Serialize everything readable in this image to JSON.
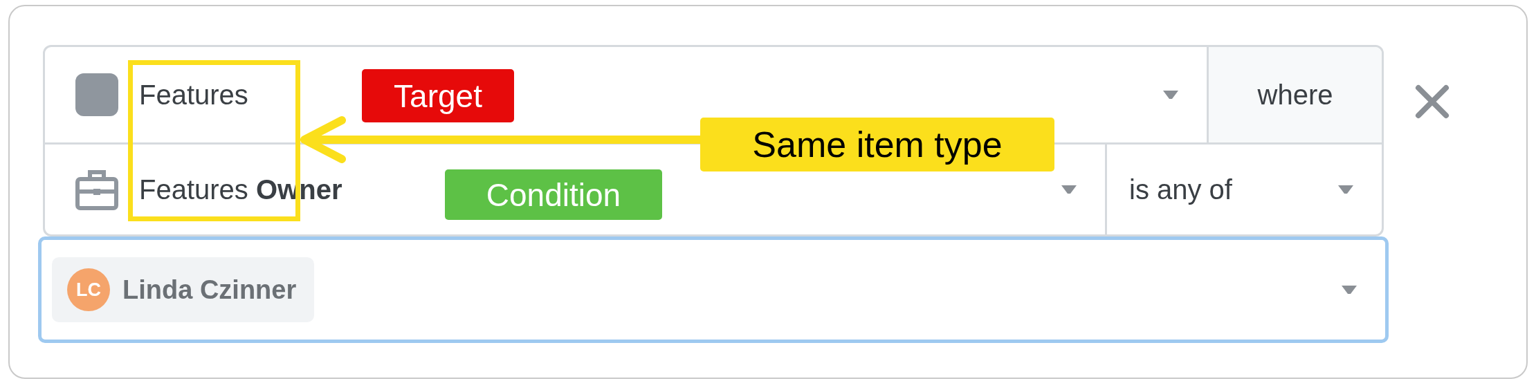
{
  "filter": {
    "target": {
      "label": "Features",
      "connector": "where"
    },
    "condition": {
      "field": "Features **Owner**",
      "operator": "is any of"
    },
    "values": [
      {
        "initials": "LC",
        "name": "Linda Czinner",
        "color": "#f5a46b"
      }
    ]
  },
  "annotations": [
    {
      "kind": "frame",
      "color": "#fbdf1c"
    },
    {
      "kind": "badge",
      "text": "Target",
      "color": "#e60a0a"
    },
    {
      "kind": "callout",
      "text": "Same item type",
      "color": "#fbdf1c"
    },
    {
      "kind": "badge",
      "text": "Condition",
      "color": "#5dc146"
    }
  ]
}
